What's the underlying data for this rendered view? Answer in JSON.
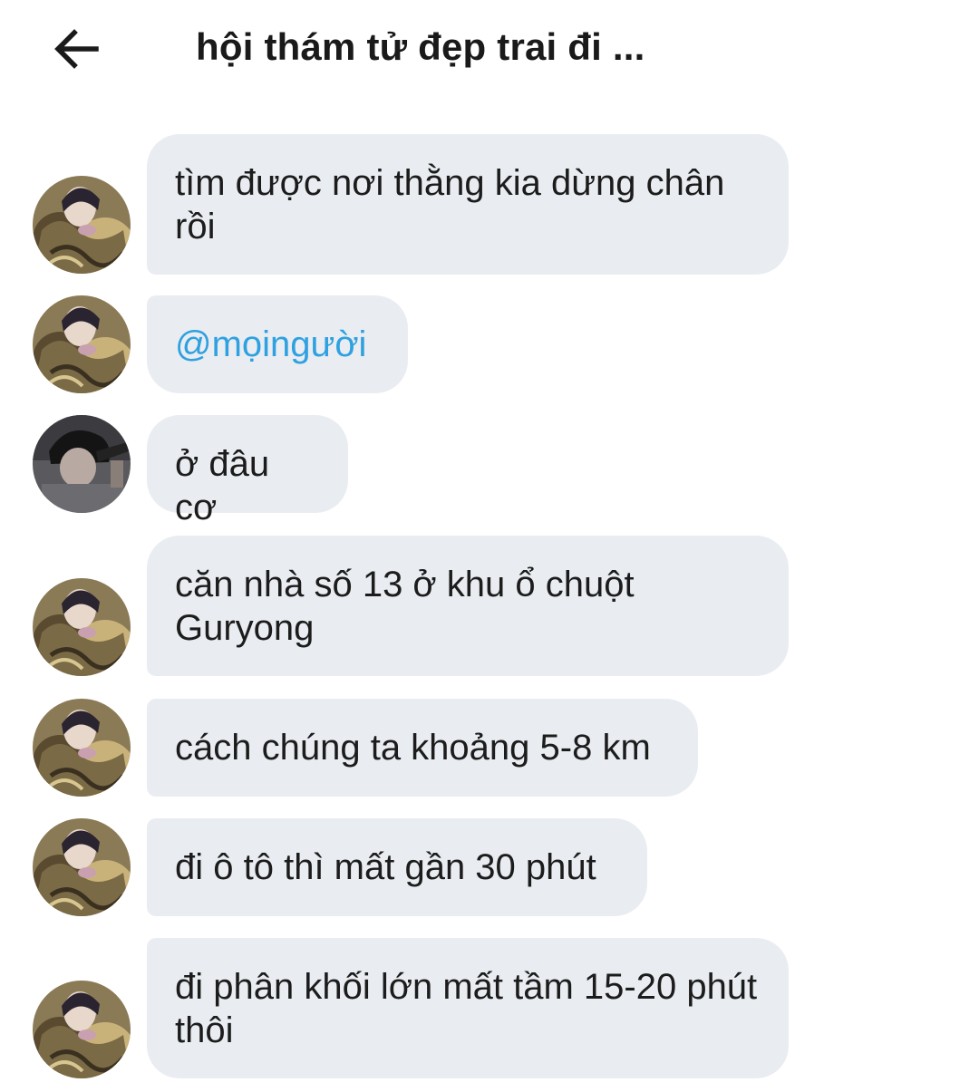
{
  "header": {
    "title": "hội thám tử đẹp trai đi ..."
  },
  "colors": {
    "bubble_bg": "#e9edf1",
    "mention": "#2fa0e0",
    "text": "#1c1c1c"
  },
  "messages": [
    {
      "sender": "avatar-a",
      "text": "tìm được nơi thằng kia dừng chân rồi"
    },
    {
      "sender": "avatar-a",
      "text": "@mọingười",
      "is_mention": true
    },
    {
      "sender": "avatar-b",
      "text": "ở đâu cơ"
    },
    {
      "sender": "avatar-a",
      "text": "căn nhà số 13 ở khu ổ chuột Guryong"
    },
    {
      "sender": "avatar-a",
      "text": "cách chúng ta khoảng 5-8 km"
    },
    {
      "sender": "avatar-a",
      "text": "đi ô tô thì mất gần 30 phút"
    },
    {
      "sender": "avatar-a",
      "text": "đi phân khối lớn mất tầm 15-20 phút thôi"
    }
  ]
}
